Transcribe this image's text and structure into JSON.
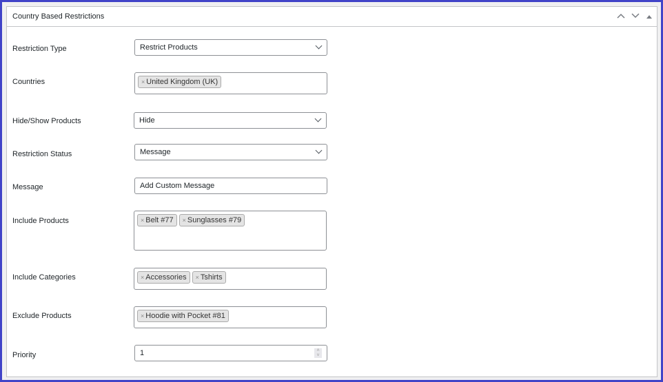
{
  "panel": {
    "title": "Country Based Restrictions"
  },
  "icons": {
    "up": "chevron-up-icon",
    "down": "chevron-down-icon",
    "toggle": "triangle-up-icon"
  },
  "fields": {
    "restriction_type": {
      "label": "Restriction Type",
      "value": "Restrict Products"
    },
    "countries": {
      "label": "Countries",
      "tags": [
        "United Kingdom (UK)"
      ]
    },
    "hide_show": {
      "label": "Hide/Show Products",
      "value": "Hide"
    },
    "restriction_status": {
      "label": "Restriction Status",
      "value": "Message"
    },
    "message": {
      "label": "Message",
      "value": "Add Custom Message"
    },
    "include_products": {
      "label": "Include Products",
      "tags": [
        "Belt #77",
        "Sunglasses #79"
      ]
    },
    "include_categories": {
      "label": "Include Categories",
      "tags": [
        "Accessories",
        "Tshirts"
      ]
    },
    "exclude_products": {
      "label": "Exclude Products",
      "tags": [
        "Hoodie with Pocket #81"
      ]
    },
    "priority": {
      "label": "Priority",
      "value": "1"
    }
  }
}
